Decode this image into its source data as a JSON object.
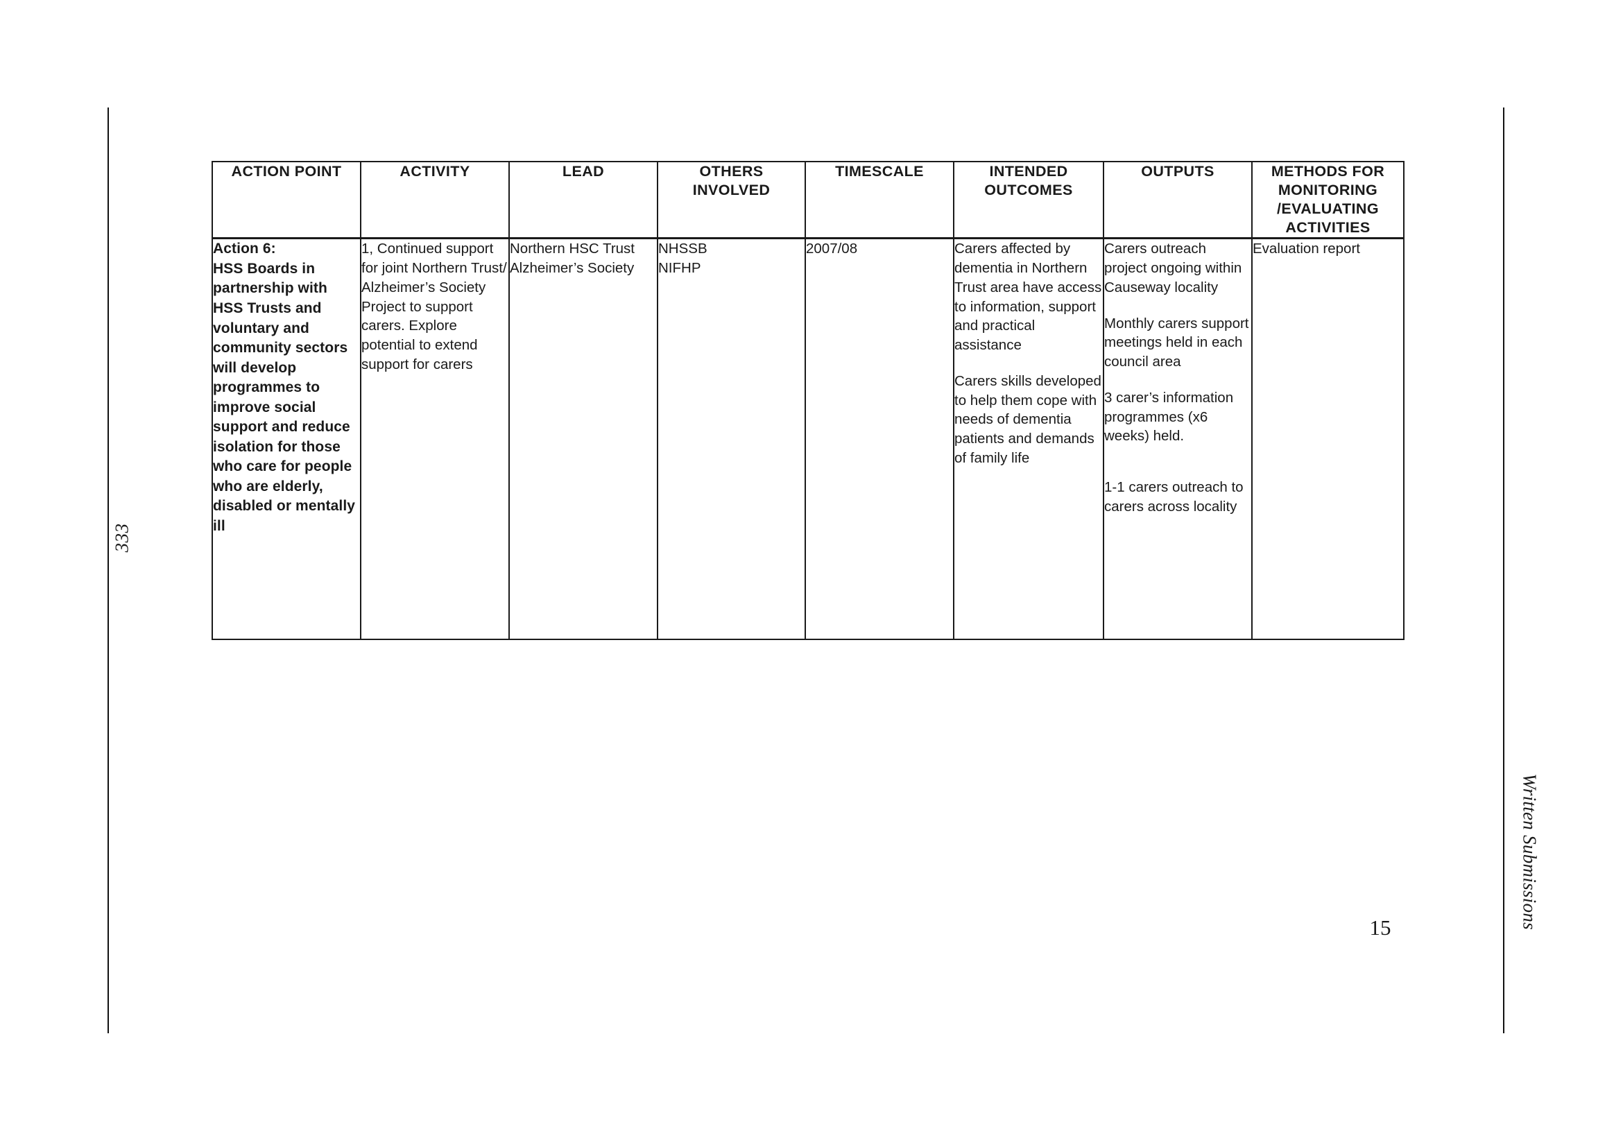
{
  "page": {
    "folio_left": "333",
    "running_head_right": "Written Submissions",
    "page_number": "15"
  },
  "table": {
    "headers": [
      "ACTION POINT",
      "ACTIVITY",
      "LEAD",
      "OTHERS INVOLVED",
      "TIMESCALE",
      "INTENDED OUTCOMES",
      "OUTPUTS",
      "METHODS FOR MONITORING /EVALUATING ACTIVITIES"
    ],
    "header_lines": {
      "others_involved": [
        "OTHERS",
        "INVOLVED"
      ],
      "intended_outcomes": [
        "INTENDED",
        "OUTCOMES"
      ],
      "methods": [
        "METHODS FOR",
        "MONITORING",
        "/EVALUATING",
        "ACTIVITIES"
      ]
    },
    "rows": [
      {
        "action_point_label": "Action 6:",
        "action_point_text": "HSS Boards in partnership with HSS Trusts and voluntary and community sectors will develop programmes to improve social support and reduce isolation for those who care for people who are elderly, disabled or mentally ill",
        "activity": "1, Continued support for joint Northern Trust/ Alzheimer’s Society Project to support carers. Explore potential to extend support for carers",
        "lead": [
          "Northern HSC Trust",
          "Alzheimer’s Society"
        ],
        "others_involved": [
          "NHSSB",
          "NIFHP"
        ],
        "timescale": "2007/08",
        "intended_outcomes": [
          "Carers affected by dementia in Northern Trust area have access to information, support and practical assistance",
          "Carers skills developed to help them cope with needs of dementia patients and demands of family life"
        ],
        "outputs": [
          "Carers outreach project ongoing within Causeway locality",
          "Monthly carers support meetings held in each council area",
          "3 carer’s information programmes (x6 weeks) held.",
          "1-1 carers outreach to carers across locality"
        ],
        "methods": "Evaluation report"
      }
    ]
  }
}
